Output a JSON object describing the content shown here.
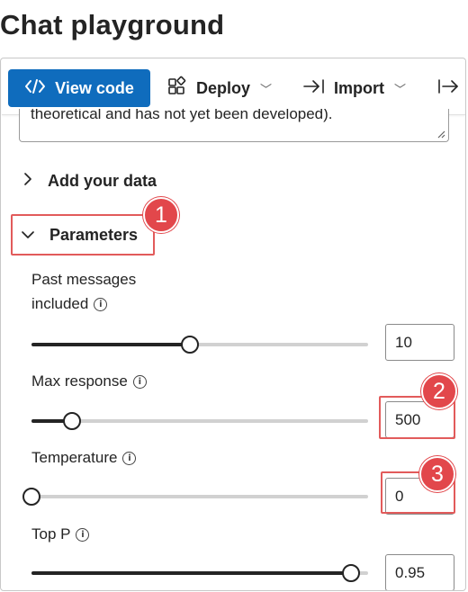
{
  "page": {
    "title": "Chat playground"
  },
  "toolbar": {
    "view_code": "View code",
    "deploy": "Deploy",
    "import": "Import"
  },
  "system_message": {
    "visible_text": "theoretical and has not yet been developed)."
  },
  "sections": {
    "add_data": "Add your data",
    "parameters": "Parameters"
  },
  "params": {
    "past_messages": {
      "label_line1": "Past messages",
      "label_line2": "included",
      "value": "10",
      "fraction": 0.47
    },
    "max_response": {
      "label": "Max response",
      "value": "500",
      "fraction": 0.12
    },
    "temperature": {
      "label": "Temperature",
      "value": "0",
      "fraction": 0.0
    },
    "top_p": {
      "label": "Top P",
      "value": "0.95",
      "fraction": 0.95
    }
  },
  "callouts": [
    {
      "number": "1"
    },
    {
      "number": "2"
    },
    {
      "number": "3"
    }
  ],
  "colors": {
    "primary": "#0f6cbd",
    "callout": "#e2474b",
    "text": "#242424"
  }
}
